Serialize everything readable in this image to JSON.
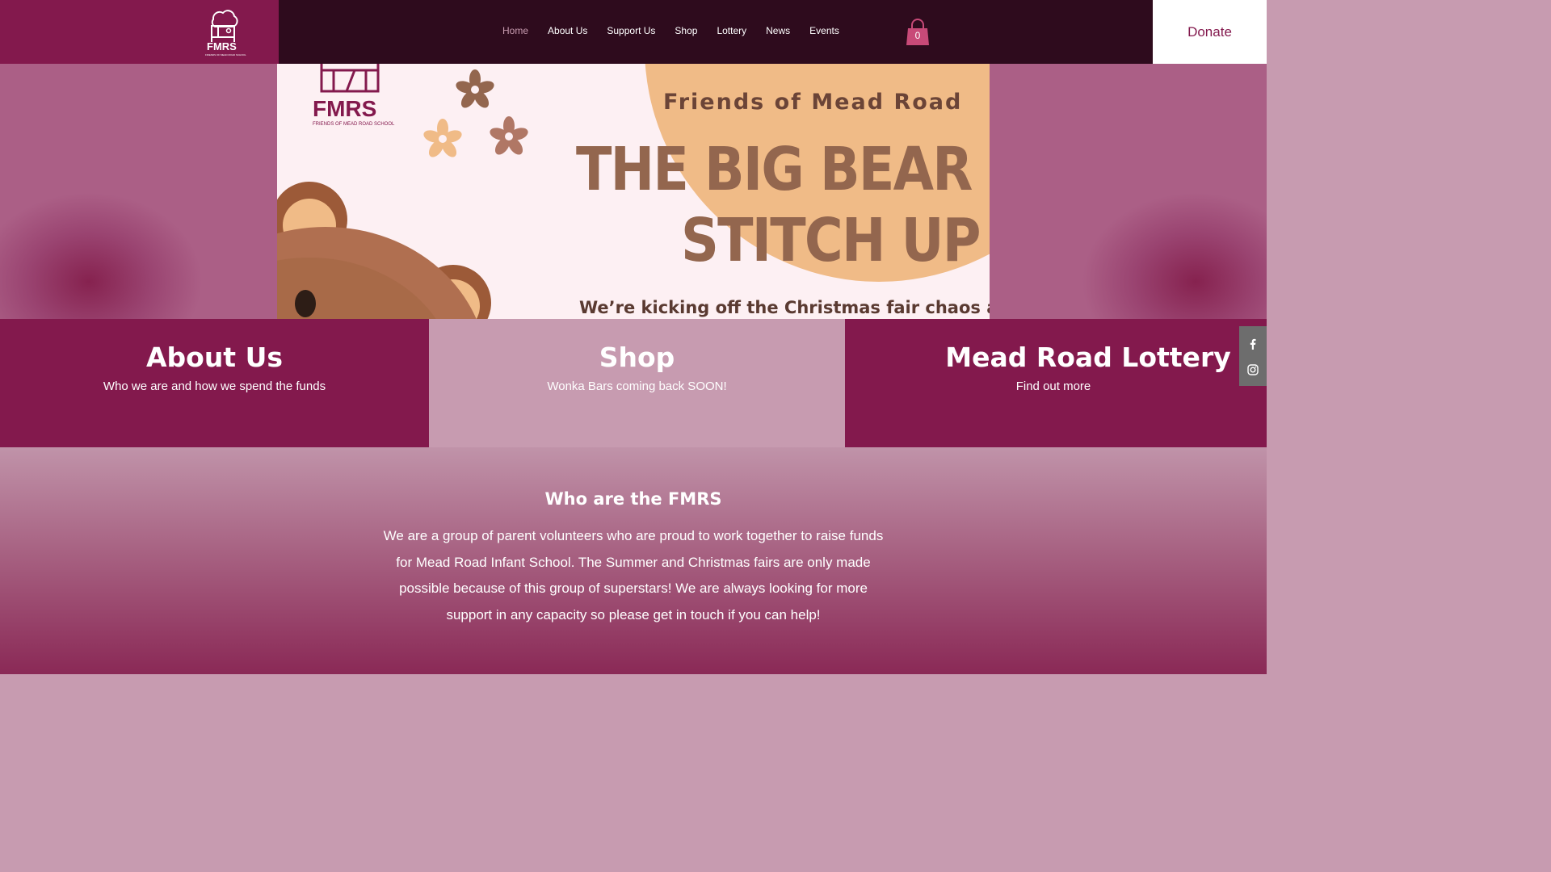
{
  "header": {
    "logo_text": "FMRS",
    "logo_subtext": "FRIENDS OF MEAD ROAD SCHOOL",
    "nav": [
      {
        "label": "Home",
        "active": true
      },
      {
        "label": "About Us"
      },
      {
        "label": "Support Us"
      },
      {
        "label": "Shop"
      },
      {
        "label": "Lottery"
      },
      {
        "label": "News"
      },
      {
        "label": "Events"
      }
    ],
    "cart_count": "0",
    "donate_label": "Donate"
  },
  "hero": {
    "logo_text": "FMRS",
    "logo_subtext": "FRIENDS OF MEAD ROAD SCHOOL",
    "friends_text": "Friends of Mead Road",
    "title_line1": "THE BIG BEAR",
    "title_line2": "STITCH UP",
    "subtitle": "We’re kicking off the Christmas fair chaos a"
  },
  "tiles": [
    {
      "title": "About Us",
      "subtitle": "Who we are and how we spend the funds"
    },
    {
      "title": "Shop",
      "subtitle": "Wonka Bars coming back SOON!"
    },
    {
      "title": "Mead Road Lottery",
      "subtitle": "Find out more"
    }
  ],
  "social": [
    {
      "icon": "facebook-icon"
    },
    {
      "icon": "instagram-icon"
    }
  ],
  "about": {
    "title": "Who are the FMRS",
    "lines": [
      "We are a group of parent volunteers who are proud to work together to raise funds",
      "for Mead Road Infant School. The Summer and Christmas fairs are only made",
      "possible because of this group of superstars! We are always looking for more",
      "support in any capacity so please get in touch if you can help!"
    ]
  },
  "colors": {
    "primary": "#83194d",
    "dark": "#2e0b1d",
    "light_pink": "#c79bb0",
    "bear_brown": "#93664e"
  }
}
